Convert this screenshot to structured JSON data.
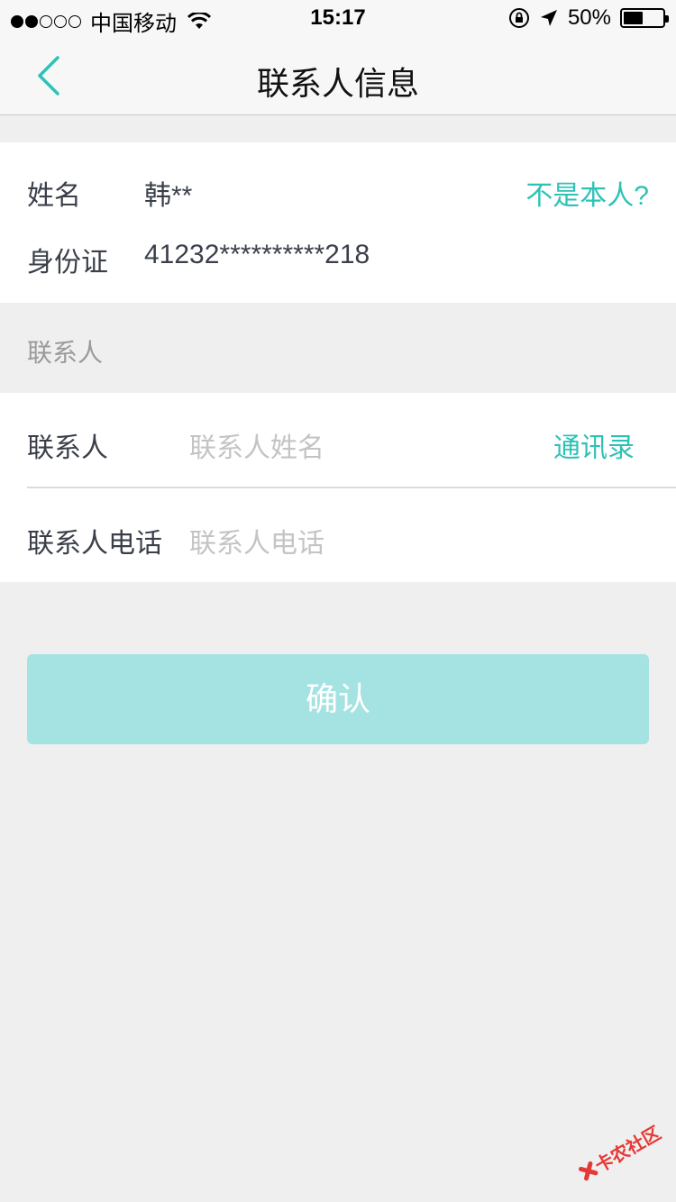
{
  "status_bar": {
    "signal_dots_filled": 2,
    "signal_dots_total": 5,
    "carrier": "中国移动",
    "time": "15:17",
    "battery_percent": "50%",
    "battery_level": 0.5
  },
  "nav": {
    "title": "联系人信息",
    "back_icon": "chevron-left-icon"
  },
  "identity": {
    "name_label": "姓名",
    "name_value": "韩**",
    "not_me_link": "不是本人?",
    "id_label": "身份证",
    "id_value": "41232**********218"
  },
  "contact_section": {
    "title": "联系人",
    "name_label": "联系人",
    "name_placeholder": "联系人姓名",
    "address_book_link": "通讯录",
    "phone_label": "联系人电话",
    "phone_placeholder": "联系人电话"
  },
  "confirm_button": "确认",
  "watermark": {
    "text": "卡农社区"
  },
  "colors": {
    "accent": "#2ec2b6",
    "button_bg": "#a5e3e2",
    "page_bg": "#efefef"
  }
}
